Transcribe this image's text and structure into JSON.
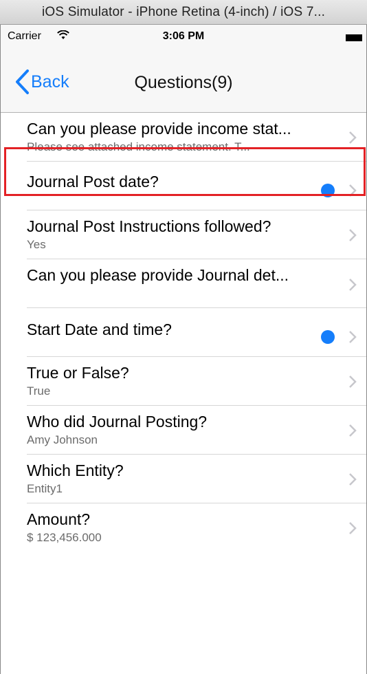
{
  "window": {
    "title": "iOS Simulator - iPhone Retina (4-inch) / iOS 7..."
  },
  "status_bar": {
    "carrier": "Carrier",
    "time": "3:06 PM"
  },
  "nav": {
    "back_label": "Back",
    "title": "Questions(9)"
  },
  "colors": {
    "accent": "#157efb",
    "highlight": "#e32125",
    "separator": "#d6d6d6",
    "subtitle": "#6b6b6b"
  },
  "questions": [
    {
      "title": "Can you please provide income stat...",
      "subtitle": "Please see attached income statement. T...",
      "unanswered": false
    },
    {
      "title": "Journal Post date?",
      "subtitle": "",
      "unanswered": true
    },
    {
      "title": "Journal Post Instructions followed?",
      "subtitle": "Yes",
      "unanswered": false
    },
    {
      "title": "Can you please provide Journal det...",
      "subtitle": "",
      "unanswered": false
    },
    {
      "title": "Start Date and time?",
      "subtitle": "",
      "unanswered": true
    },
    {
      "title": "True or False?",
      "subtitle": "True",
      "unanswered": false
    },
    {
      "title": "Who did Journal Posting?",
      "subtitle": "Amy Johnson",
      "unanswered": false
    },
    {
      "title": "Which Entity?",
      "subtitle": "Entity1",
      "unanswered": false
    },
    {
      "title": "Amount?",
      "subtitle": "$ 123,456.000",
      "unanswered": false
    }
  ]
}
